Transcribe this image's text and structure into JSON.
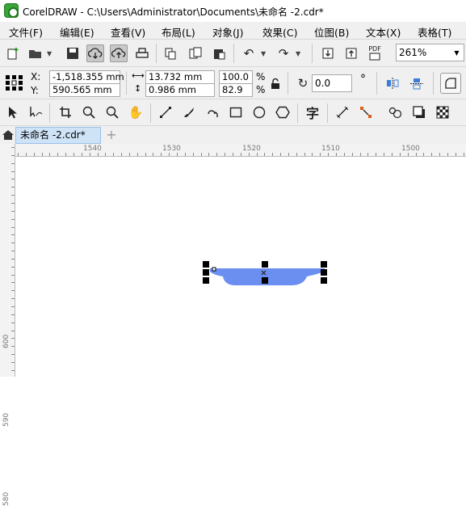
{
  "window": {
    "title": "CorelDRAW - C:\\Users\\Administrator\\Documents\\未命名 -2.cdr*"
  },
  "menu": [
    {
      "label": "文件(F)"
    },
    {
      "label": "编辑(E)"
    },
    {
      "label": "查看(V)"
    },
    {
      "label": "布局(L)"
    },
    {
      "label": "对象(J)"
    },
    {
      "label": "效果(C)"
    },
    {
      "label": "位图(B)"
    },
    {
      "label": "文本(X)"
    },
    {
      "label": "表格(T)"
    }
  ],
  "toolbar": {
    "icons": [
      "new-document-icon",
      "open-folder-icon",
      "save-icon",
      "cloud-download-icon",
      "cloud-upload-icon",
      "print-icon",
      "import-icon",
      "export-icon",
      "clipboard-icon",
      "undo-icon",
      "redo-icon",
      "publish-import-icon",
      "publish-export-icon",
      "pdf-icon"
    ],
    "pdf_label": "PDF",
    "zoom_value": "261%"
  },
  "properties": {
    "x_label": "X:",
    "y_label": "Y:",
    "x_value": "-1,518.355 mm",
    "y_value": "590.565 mm",
    "width_value": "13.732 mm",
    "height_value": "0.986 mm",
    "scale_x": "100.0",
    "scale_y": "82.9",
    "percent": "%",
    "rotation_value": "0.0",
    "degree_symbol": "°"
  },
  "toolbox": {
    "tools": [
      "pick-tool-icon",
      "shape-tool-icon",
      "crop-tool-icon",
      "zoom-tool-icon",
      "pan-tool-icon",
      "freehand-tool-icon",
      "artistic-media-icon",
      "pen-curve-icon",
      "rectangle-tool-icon",
      "ellipse-tool-icon",
      "polygon-tool-icon",
      "text-tool-icon",
      "parallel-dimension-icon",
      "connector-tool-icon",
      "blend-tool-icon",
      "drop-shadow-icon",
      "transparency-icon"
    ],
    "text_tool_glyph": "字"
  },
  "tabs": {
    "document_tab": "未命名 -2.cdr*",
    "add_tab": "+"
  },
  "ruler": {
    "h_labels": [
      "1540",
      "1530",
      "1520",
      "1510",
      "1500"
    ],
    "v_labels": [
      "600",
      "590",
      "580"
    ]
  },
  "colors": {
    "shape_fill": "#6b8ff0",
    "tab_bg": "#cfe3f7",
    "toolbar_bg": "#f0f0f0"
  }
}
